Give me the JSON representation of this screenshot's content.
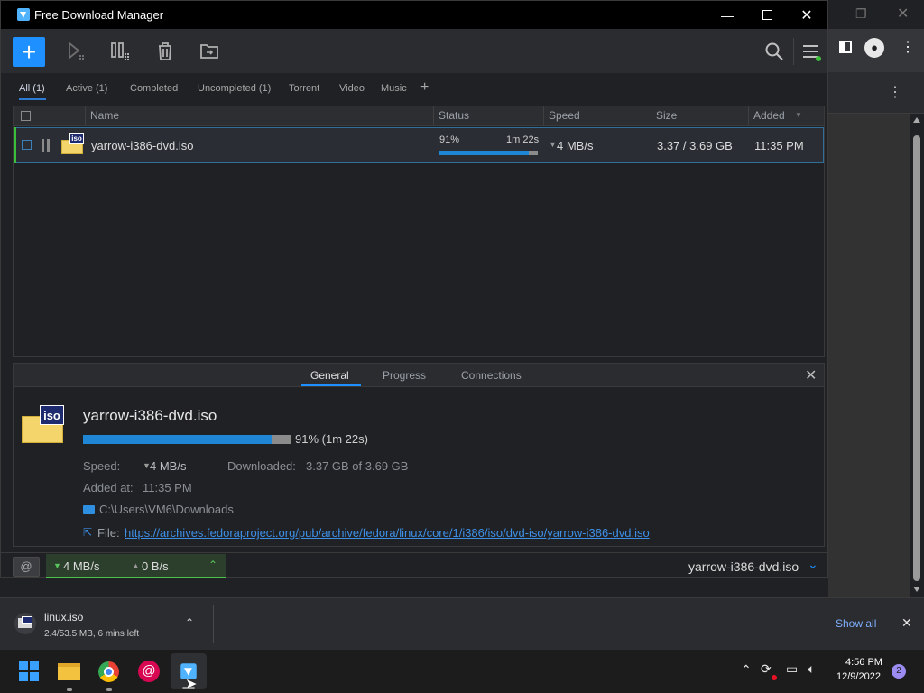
{
  "window": {
    "title": "Free Download Manager"
  },
  "toolbar": {
    "add_label": "+"
  },
  "filters": [
    {
      "label": "All (1)"
    },
    {
      "label": "Active (1)"
    },
    {
      "label": "Completed"
    },
    {
      "label": "Uncompleted (1)"
    },
    {
      "label": "Torrent"
    },
    {
      "label": "Video"
    },
    {
      "label": "Music"
    },
    {
      "label": "+"
    }
  ],
  "columns": {
    "name": "Name",
    "status": "Status",
    "speed": "Speed",
    "size": "Size",
    "added": "Added"
  },
  "download": {
    "name": "yarrow-i386-dvd.iso",
    "icon_text": "iso",
    "percent_text": "91%",
    "time_left": "1m 22s",
    "progress": 0.91,
    "speed": "4 MB/s",
    "size": "3.37 / 3.69 GB",
    "added": "11:35 PM"
  },
  "details": {
    "tabs": [
      "General",
      "Progress",
      "Connections"
    ],
    "file_name": "yarrow-i386-dvd.iso",
    "progress_text": "91% (1m 22s)",
    "speed_label": "Speed:",
    "speed_value": "4 MB/s",
    "downloaded_label": "Downloaded:",
    "downloaded_value": "3.37 GB of 3.69 GB",
    "added_label": "Added at:",
    "added_value": "11:35 PM",
    "folder": "C:\\Users\\VM6\\Downloads",
    "file_label": "File:",
    "url": "https://archives.fedoraproject.org/pub/archive/fedora/linux/core/1/i386/iso/dvd-iso/yarrow-i386-dvd.iso"
  },
  "statusbar": {
    "down_speed": "4 MB/s",
    "up_speed": "0 B/s",
    "current_file": "yarrow-i386-dvd.iso"
  },
  "shelf": {
    "file_name": "linux.iso",
    "status": "2.4/53.5 MB, 6 mins left",
    "show_all": "Show all"
  },
  "taskbar": {
    "time": "4:56 PM",
    "date": "12/9/2022",
    "notifications": "2"
  },
  "colors": {
    "accent": "#1e90ff",
    "progress": "#1f86d6",
    "active_green": "#3bbf3b",
    "link": "#3d8fe6"
  }
}
